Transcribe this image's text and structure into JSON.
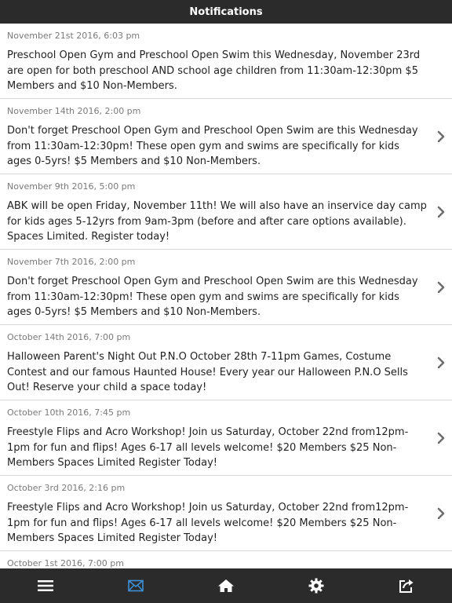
{
  "header": {
    "title": "Notifications"
  },
  "notifications": [
    {
      "date": "November 21st 2016, 6:03 pm",
      "message": "Preschool Open Gym and Preschool Open Swim this Wednesday, November 23rd are open for both preschool AND school age children from 11:30am-12:30pm $5 Members and $10 Non-Members.",
      "has_chevron": false
    },
    {
      "date": "November 14th 2016, 2:00 pm",
      "message": "Don't forget Preschool Open Gym and Preschool Open Swim are this Wednesday from 11:30am-12:30pm! These open gym and swims are specifically for kids ages 0-5yrs! $5 Members and $10 Non-Members.",
      "has_chevron": true
    },
    {
      "date": "November 9th 2016, 5:00 pm",
      "message": "ABK will be open Friday, November 11th! We will also have an inservice day camp for kids ages 5-12yrs from 9am-3pm (before and after care options available). Spaces Limited. Register today!",
      "has_chevron": true
    },
    {
      "date": "November 7th 2016, 2:00 pm",
      "message": "Don't forget Preschool Open Gym and Preschool Open Swim are this Wednesday from 11:30am-12:30pm! These open gym and swims are specifically for kids ages 0-5yrs! $5 Members and $10 Non-Members.",
      "has_chevron": true
    },
    {
      "date": "October 14th 2016, 7:00 pm",
      "message": "Halloween Parent's Night Out P.N.O October 28th 7-11pm Games, Costume Contest and our famous Haunted House! Every year our Halloween P.N.O Sells Out! Reserve your child a space today!",
      "has_chevron": true
    },
    {
      "date": "October 10th 2016, 7:45 pm",
      "message": "Freestyle Flips and Acro Workshop! Join us Saturday, October 22nd from12pm-1pm for fun and flips! Ages 6-17 all levels welcome! $20 Members $25 Non-Members Spaces Limited Register Today!",
      "has_chevron": true
    },
    {
      "date": "October 3rd 2016, 2:16 pm",
      "message": "Freestyle Flips and Acro Workshop! Join us Saturday, October 22nd from12pm-1pm for fun and flips! Ages 6-17 all levels welcome! $20 Members $25 Non-Members Spaces Limited Register Today!",
      "has_chevron": true
    },
    {
      "date": "October 1st 2016, 7:00 pm",
      "message": "",
      "has_chevron": false
    }
  ],
  "tabbar": {
    "tabs": [
      {
        "icon": "menu-icon",
        "active": false
      },
      {
        "icon": "envelope-icon",
        "active": true
      },
      {
        "icon": "home-icon",
        "active": false
      },
      {
        "icon": "gear-icon",
        "active": false
      },
      {
        "icon": "share-icon",
        "active": false
      }
    ],
    "colors": {
      "active": "#3d8fd8",
      "inactive": "#ffffff",
      "background": "#2b2b2b"
    }
  }
}
